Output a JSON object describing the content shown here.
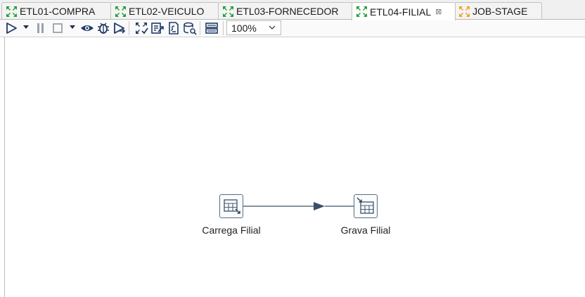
{
  "tabs": [
    {
      "label": "ETL01-COMPRA",
      "icon": "transformation-icon",
      "active": false
    },
    {
      "label": "ETL02-VEICULO",
      "icon": "transformation-icon",
      "active": false
    },
    {
      "label": "ETL03-FORNECEDOR",
      "icon": "transformation-icon",
      "active": false
    },
    {
      "label": "ETL04-FILIAL",
      "icon": "transformation-icon",
      "active": true,
      "close": "⊠"
    },
    {
      "label": "JOB-STAGE",
      "icon": "job-icon",
      "active": false
    }
  ],
  "toolbar": {
    "icons": [
      "run-icon",
      "pause-icon",
      "stop-icon",
      "preview-icon",
      "debug-icon",
      "replay-icon",
      "verify-icon",
      "impact-icon",
      "sql-icon",
      "explore-db-icon",
      "show-results-icon"
    ],
    "zoom_value": "100%"
  },
  "canvas": {
    "steps": [
      {
        "name": "Carrega Filial",
        "icon": "table-input-icon"
      },
      {
        "name": "Grava Filial",
        "icon": "table-output-icon"
      }
    ],
    "hop": {
      "from": "Carrega Filial",
      "to": "Grava Filial"
    }
  },
  "colors": {
    "transformation_icon": "#1f9e3a",
    "job_icon": "#f0a020",
    "toolbar_icon": "#1f3a66",
    "hop_line": "#3b5068"
  }
}
